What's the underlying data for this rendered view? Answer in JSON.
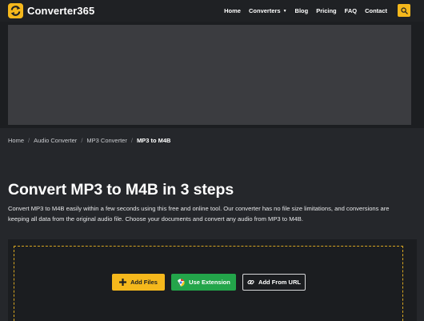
{
  "header": {
    "brand": "Converter365",
    "nav": [
      {
        "label": "Home"
      },
      {
        "label": "Converters",
        "has_dropdown": true
      },
      {
        "label": "Blog"
      },
      {
        "label": "Pricing"
      },
      {
        "label": "FAQ"
      },
      {
        "label": "Contact"
      }
    ],
    "search_icon": "search-icon"
  },
  "breadcrumb": {
    "items": [
      "Home",
      "Audio Converter",
      "MP3 Converter"
    ],
    "current": "MP3 to M4B",
    "separator": "/"
  },
  "main": {
    "title": "Convert MP3 to M4B in 3 steps",
    "description": "Convert MP3 to M4B easily within a few seconds using this free and online tool. Our converter has no file size limitations, and conversions are keeping all data from the original audio file. Choose your documents and convert any audio from MP3 to M4B."
  },
  "upload": {
    "add_files": "Add Files",
    "use_extension": "Use Extension",
    "add_from_url": "Add From URL"
  },
  "colors": {
    "accent": "#f5b81c",
    "extension_green": "#23a54a",
    "background": "#25272b",
    "header_bg": "#1f2124"
  }
}
